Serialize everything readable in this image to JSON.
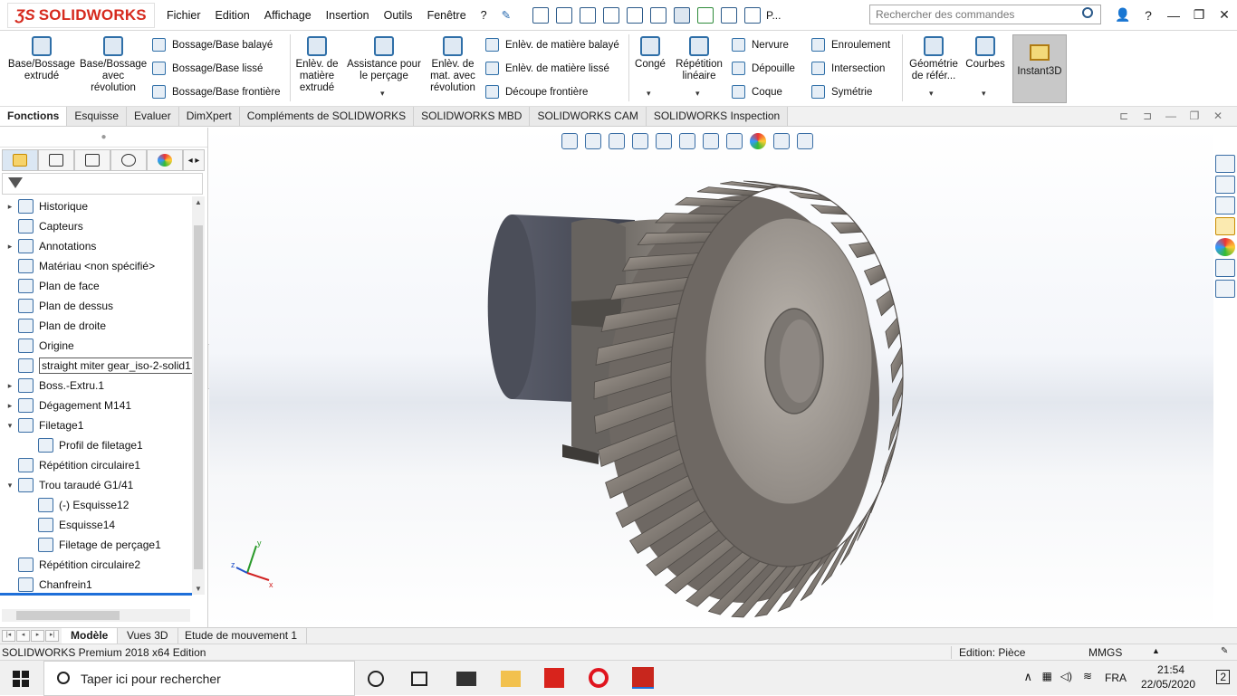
{
  "app": {
    "logo_text": "SOLIDWORKS",
    "menus": [
      "Fichier",
      "Edition",
      "Affichage",
      "Insertion",
      "Outils",
      "Fenêtre",
      "?"
    ],
    "quick_access_tail": "P...",
    "search_placeholder": "Rechercher des commandes",
    "help_label": "?"
  },
  "command_manager": {
    "extrude_label": "Base/Bossage extrudé",
    "revolve_label": "Base/Bossage avec révolution",
    "swept_boss": "Bossage/Base balayé",
    "lofted_boss": "Bossage/Base lissé",
    "boundary_boss": "Bossage/Base frontière",
    "extruded_cut": "Enlèv. de matière extrudé",
    "hole_wizard": "Assistance pour le perçage",
    "revolved_cut": "Enlèv. de mat. avec révolution",
    "swept_cut": "Enlèv. de matière balayé",
    "lofted_cut": "Enlèv. de matière lissé",
    "boundary_cut": "Découpe frontière",
    "fillet": "Congé",
    "linear_pattern": "Répétition linéaire",
    "rib": "Nervure",
    "draft": "Dépouille",
    "shell": "Coque",
    "wrap": "Enroulement",
    "intersect": "Intersection",
    "mirror": "Symétrie",
    "ref_geometry": "Géométrie de référ...",
    "curves": "Courbes",
    "instant3d": "Instant3D"
  },
  "command_tabs": [
    "Fonctions",
    "Esquisse",
    "Evaluer",
    "DimXpert",
    "Compléments de SOLIDWORKS",
    "SOLIDWORKS MBD",
    "SOLIDWORKS CAM",
    "SOLIDWORKS Inspection"
  ],
  "feature_tree": [
    {
      "label": "Historique",
      "expander": "▸",
      "icon": "history-icon"
    },
    {
      "label": "Capteurs",
      "expander": "",
      "icon": "sensors-icon"
    },
    {
      "label": "Annotations",
      "expander": "▸",
      "icon": "annotations-icon"
    },
    {
      "label": "Matériau <non spécifié>",
      "expander": "",
      "icon": "material-icon"
    },
    {
      "label": "Plan de face",
      "expander": "",
      "icon": "plane-icon"
    },
    {
      "label": "Plan de dessus",
      "expander": "",
      "icon": "plane-icon"
    },
    {
      "label": "Plan de droite",
      "expander": "",
      "icon": "plane-icon"
    },
    {
      "label": "Origine",
      "expander": "",
      "icon": "origin-icon"
    },
    {
      "label": "straight miter gear_iso-2-solid1",
      "expander": "",
      "icon": "imported-body-icon"
    },
    {
      "label": "Boss.-Extru.1",
      "expander": "▸",
      "icon": "extrude-icon"
    },
    {
      "label": "Dégagement M141",
      "expander": "▸",
      "icon": "hole-icon"
    },
    {
      "label": "Filetage1",
      "expander": "▾",
      "icon": "thread-icon"
    },
    {
      "label": "Profil de filetage1",
      "expander": "",
      "icon": "sketch-icon",
      "indent": 1
    },
    {
      "label": "Répétition circulaire1",
      "expander": "",
      "icon": "circular-pattern-icon"
    },
    {
      "label": "Trou taraudé G1/41",
      "expander": "▾",
      "icon": "hole-icon"
    },
    {
      "label": "(-) Esquisse12",
      "expander": "",
      "icon": "sketch-icon",
      "indent": 1
    },
    {
      "label": "Esquisse14",
      "expander": "",
      "icon": "sketch-icon",
      "indent": 1
    },
    {
      "label": "Filetage de perçage1",
      "expander": "",
      "icon": "cosmetic-thread-icon",
      "indent": 1
    },
    {
      "label": "Répétition circulaire2",
      "expander": "",
      "icon": "circular-pattern-icon"
    },
    {
      "label": "Chanfrein1",
      "expander": "",
      "icon": "chamfer-icon"
    }
  ],
  "bottom_tabs": [
    "Modèle",
    "Vues 3D",
    "Etude de mouvement 1"
  ],
  "status": {
    "edition": "SOLIDWORKS Premium 2018 x64 Edition",
    "editing": "Edition: Pièce",
    "units": "MMGS"
  },
  "taskbar": {
    "search_placeholder": "Taper ici pour rechercher",
    "lang": "FRA",
    "time": "21:54",
    "date": "22/05/2020",
    "notifications": "2"
  },
  "triad": {
    "x": "x",
    "y": "y",
    "z": "z"
  },
  "colors": {
    "brand": "#d62a1e",
    "accent": "#1e6fd9"
  }
}
